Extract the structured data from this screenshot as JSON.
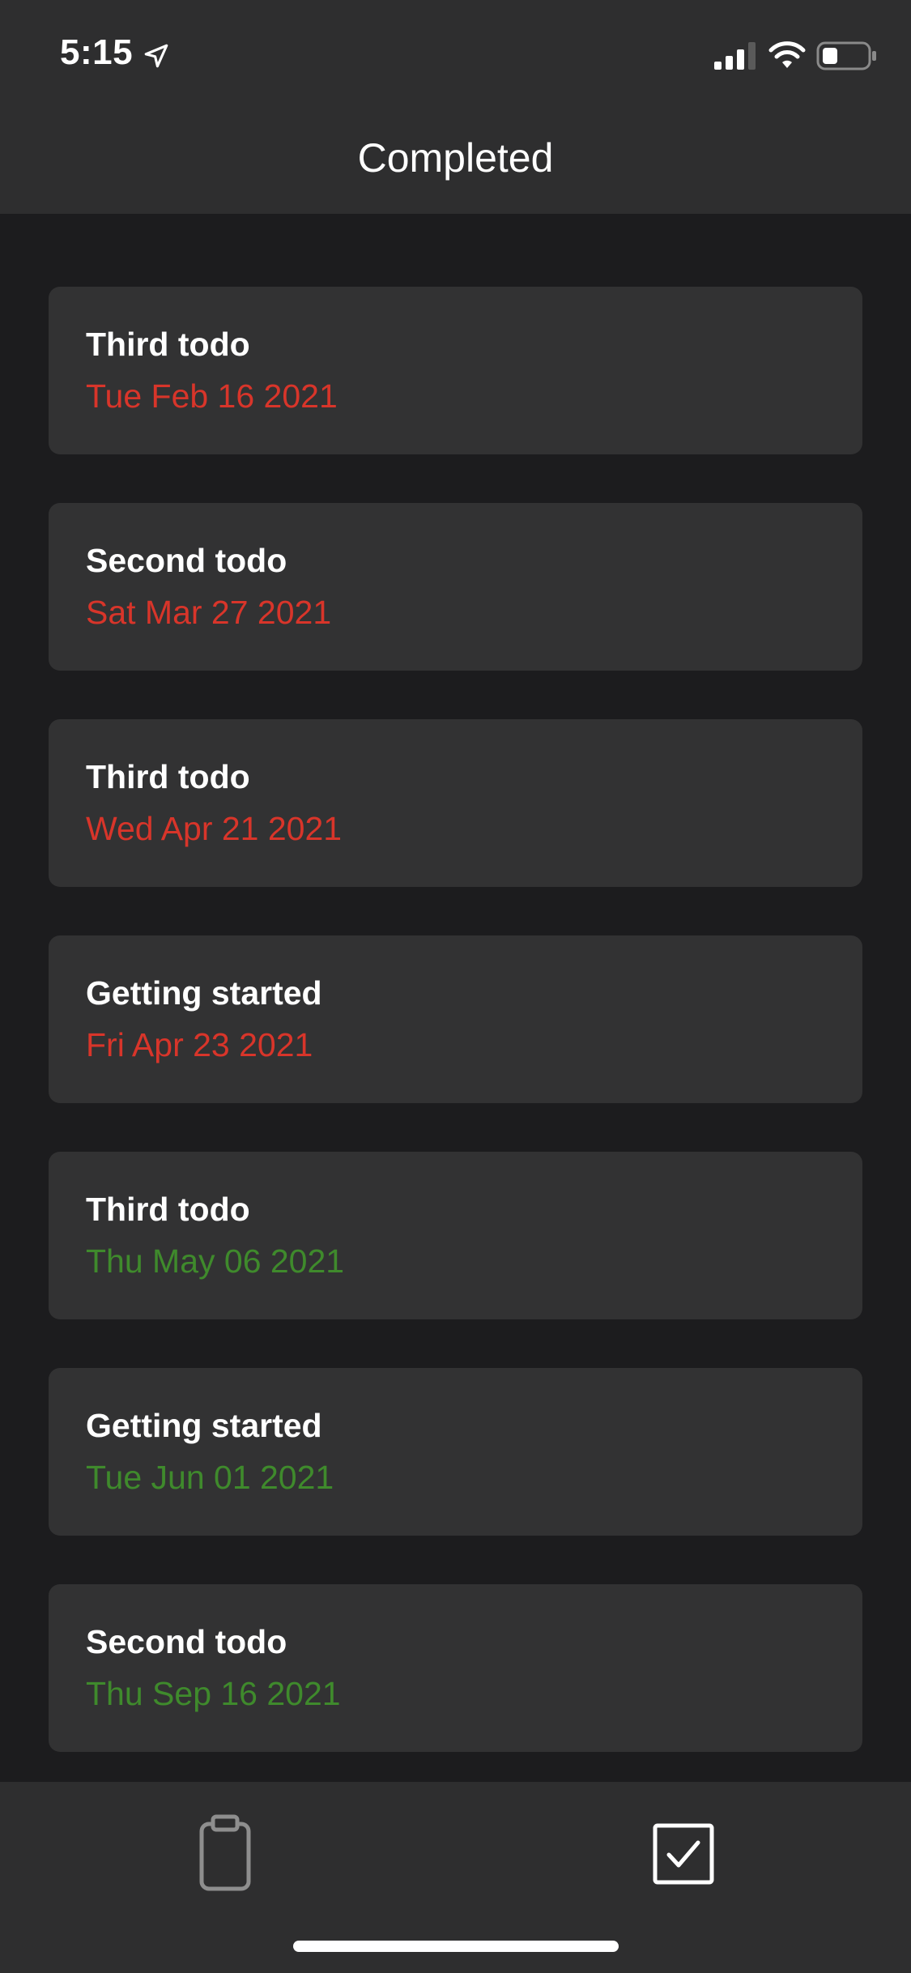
{
  "status_bar": {
    "time": "5:15",
    "icons": [
      "location-arrow-icon",
      "cellular-signal-icon",
      "wifi-icon",
      "battery-icon"
    ]
  },
  "header": {
    "title": "Completed"
  },
  "todos": [
    {
      "title": "Third todo",
      "date": "Tue Feb 16 2021",
      "status": "overdue"
    },
    {
      "title": "Second todo",
      "date": "Sat Mar 27 2021",
      "status": "overdue"
    },
    {
      "title": "Third todo",
      "date": "Wed Apr 21 2021",
      "status": "overdue"
    },
    {
      "title": "Getting started",
      "date": "Fri Apr 23 2021",
      "status": "overdue"
    },
    {
      "title": "Third todo",
      "date": "Thu May 06 2021",
      "status": "upcoming"
    },
    {
      "title": "Getting started",
      "date": "Tue Jun 01 2021",
      "status": "upcoming"
    },
    {
      "title": "Second todo",
      "date": "Thu Sep 16 2021",
      "status": "upcoming"
    }
  ],
  "tab_bar": {
    "tabs": [
      {
        "icon": "clipboard-icon",
        "active": false
      },
      {
        "icon": "checkbox-checked-icon",
        "active": true
      }
    ]
  },
  "colors": {
    "background": "#1c1c1e",
    "bar": "#2e2e2f",
    "card": "#323233",
    "overdue_date": "#d8352a",
    "upcoming_date": "#3f8a2c",
    "inactive_icon": "#8e8e8e",
    "active_icon": "#ffffff"
  }
}
